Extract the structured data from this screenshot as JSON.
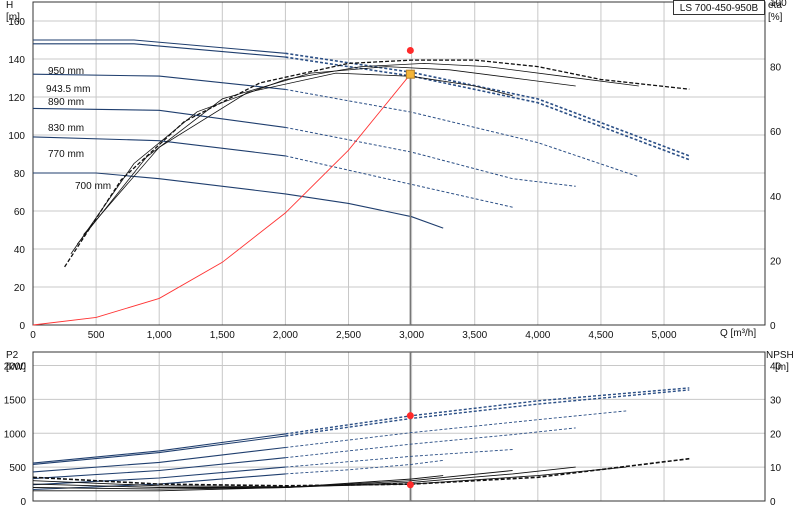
{
  "chart_data": [
    {
      "type": "line",
      "product": "LS 700-450-950B",
      "left_axis": {
        "title": "H",
        "unit": "[m]",
        "ylim": [
          0,
          170
        ],
        "ticks": [
          0,
          20,
          40,
          60,
          80,
          100,
          120,
          140,
          160
        ]
      },
      "right_axis": {
        "title": "eta",
        "unit": "[%]",
        "ylim": [
          0,
          100
        ],
        "ticks": [
          0,
          20,
          40,
          60,
          80,
          100
        ]
      },
      "x_axis": {
        "title": "Q [m³/h]",
        "xlim": [
          0,
          5800
        ],
        "ticks": [
          0,
          500,
          1000,
          1500,
          2000,
          2500,
          3000,
          3500,
          4000,
          4500,
          5000
        ],
        "tick_labels": [
          "0",
          "500",
          "1,000",
          "1,500",
          "2,000",
          "2,500",
          "3,000",
          "3,500",
          "4,000",
          "4,500",
          "5,000"
        ]
      },
      "grid": true,
      "head_curves": [
        {
          "name": "950 mm",
          "points": [
            [
              0,
              150
            ],
            [
              800,
              150
            ],
            [
              2000,
              143
            ],
            [
              3000,
              133
            ],
            [
              4000,
              119
            ],
            [
              5200,
              89
            ]
          ]
        },
        {
          "name": "943.5 mm",
          "points": [
            [
              0,
              148
            ],
            [
              800,
              148
            ],
            [
              2000,
              141
            ],
            [
              3000,
              131
            ],
            [
              4000,
              117
            ],
            [
              5200,
              87
            ]
          ]
        },
        {
          "name": "890 mm",
          "points": [
            [
              0,
              132
            ],
            [
              1000,
              131
            ],
            [
              2000,
              124
            ],
            [
              3000,
              112
            ],
            [
              4000,
              96
            ],
            [
              4800,
              78
            ]
          ]
        },
        {
          "name": "830 mm",
          "points": [
            [
              0,
              114
            ],
            [
              1000,
              113
            ],
            [
              2000,
              104
            ],
            [
              3000,
              91
            ],
            [
              3800,
              77
            ],
            [
              4300,
              73
            ]
          ]
        },
        {
          "name": "770 mm",
          "points": [
            [
              0,
              99
            ],
            [
              1000,
              97
            ],
            [
              2000,
              89
            ],
            [
              3000,
              74
            ],
            [
              3800,
              62
            ]
          ]
        },
        {
          "name": "700 mm",
          "points": [
            [
              0,
              80
            ],
            [
              500,
              80
            ],
            [
              1000,
              77
            ],
            [
              2000,
              69
            ],
            [
              2500,
              64
            ],
            [
              3000,
              57
            ],
            [
              3250,
              51
            ]
          ]
        }
      ],
      "efficiency_curves": [
        {
          "points": [
            [
              250,
              18
            ],
            [
              700,
              45
            ],
            [
              1200,
              63
            ],
            [
              1800,
              75
            ],
            [
              2500,
              81
            ],
            [
              3000,
              82
            ],
            [
              3500,
              82
            ],
            [
              4000,
              80
            ],
            [
              4500,
              76
            ],
            [
              5200,
              73
            ]
          ]
        },
        {
          "points": [
            [
              300,
              22
            ],
            [
              800,
              50
            ],
            [
              1300,
              66
            ],
            [
              2000,
              76
            ],
            [
              2600,
              80
            ],
            [
              3100,
              81
            ],
            [
              3600,
              80
            ],
            [
              4200,
              77
            ],
            [
              4800,
              74
            ]
          ]
        },
        {
          "points": [
            [
              350,
              25
            ],
            [
              900,
              52
            ],
            [
              1500,
              70
            ],
            [
              2200,
              78
            ],
            [
              2800,
              80
            ],
            [
              3300,
              79
            ],
            [
              3900,
              76
            ],
            [
              4300,
              74
            ]
          ]
        },
        {
          "points": [
            [
              400,
              28
            ],
            [
              1000,
              55
            ],
            [
              1700,
              72
            ],
            [
              2400,
              78
            ],
            [
              3000,
              77
            ],
            [
              3500,
              74
            ],
            [
              3800,
              71
            ]
          ]
        }
      ],
      "system_curve": {
        "points": [
          [
            0,
            0
          ],
          [
            500,
            4
          ],
          [
            1000,
            14
          ],
          [
            1500,
            33
          ],
          [
            2000,
            59
          ],
          [
            2500,
            92
          ],
          [
            2990,
            132
          ]
        ]
      },
      "duty_point": {
        "q": 2990,
        "h": 132
      },
      "duty_eff": {
        "q": 2990,
        "eta": 85
      },
      "duty_line": {
        "q": 2990
      }
    },
    {
      "type": "line",
      "left_axis": {
        "title": "P2",
        "unit": "[kW]",
        "ylim": [
          0,
          2200
        ],
        "ticks": [
          0,
          500,
          1000,
          1500,
          2000
        ]
      },
      "right_axis": {
        "title": "NPSH",
        "unit": "[m]",
        "ylim": [
          0,
          44
        ],
        "ticks": [
          0,
          10,
          20,
          30,
          40
        ]
      },
      "x_axis": {
        "xlim": [
          0,
          5800
        ],
        "ticks": [
          0,
          500,
          1000,
          1500,
          2000,
          2500,
          3000,
          3500,
          4000,
          4500,
          5000
        ]
      },
      "grid": true,
      "power_curves": [
        {
          "points": [
            [
              0,
              560
            ],
            [
              1000,
              740
            ],
            [
              2000,
              990
            ],
            [
              3000,
              1260
            ],
            [
              4000,
              1480
            ],
            [
              5200,
              1670
            ]
          ]
        },
        {
          "points": [
            [
              0,
              540
            ],
            [
              1000,
              715
            ],
            [
              2000,
              960
            ],
            [
              3000,
              1220
            ],
            [
              4000,
              1430
            ],
            [
              5200,
              1640
            ]
          ]
        },
        {
          "points": [
            [
              0,
              430
            ],
            [
              1000,
              570
            ],
            [
              2000,
              790
            ],
            [
              3000,
              1010
            ],
            [
              4000,
              1200
            ],
            [
              4700,
              1330
            ]
          ]
        },
        {
          "points": [
            [
              0,
              330
            ],
            [
              1000,
              450
            ],
            [
              2000,
              640
            ],
            [
              3000,
              840
            ],
            [
              3800,
              980
            ],
            [
              4300,
              1080
            ]
          ]
        },
        {
          "points": [
            [
              0,
              240
            ],
            [
              1000,
              340
            ],
            [
              2000,
              500
            ],
            [
              3000,
              660
            ],
            [
              3800,
              760
            ]
          ]
        },
        {
          "points": [
            [
              0,
              170
            ],
            [
              1000,
              250
            ],
            [
              2000,
              400
            ],
            [
              2500,
              460
            ],
            [
              3000,
              540
            ],
            [
              3250,
              600
            ]
          ]
        }
      ],
      "npsh_curves": [
        {
          "points": [
            [
              0,
              7
            ],
            [
              1000,
              5
            ],
            [
              2000,
              4.5
            ],
            [
              3000,
              5
            ],
            [
              4000,
              7
            ],
            [
              5200,
              12.5
            ]
          ]
        },
        {
          "points": [
            [
              0,
              6
            ],
            [
              1000,
              4.5
            ],
            [
              2000,
              4.2
            ],
            [
              3000,
              5
            ],
            [
              4000,
              7.5
            ],
            [
              4700,
              10
            ]
          ]
        },
        {
          "points": [
            [
              0,
              5
            ],
            [
              1000,
              4
            ],
            [
              2000,
              4
            ],
            [
              3000,
              5.5
            ],
            [
              3800,
              8
            ],
            [
              4300,
              10
            ]
          ]
        },
        {
          "points": [
            [
              0,
              4
            ],
            [
              1000,
              3.5
            ],
            [
              2000,
              4
            ],
            [
              3000,
              6
            ],
            [
              3800,
              9
            ]
          ]
        },
        {
          "points": [
            [
              0,
              3
            ],
            [
              1000,
              3
            ],
            [
              2000,
              4
            ],
            [
              3000,
              6.5
            ],
            [
              3250,
              7.5
            ]
          ]
        }
      ],
      "duty_power": {
        "q": 2990,
        "p2": 1260
      },
      "duty_npsh": {
        "q": 2990,
        "npsh": 4.8
      }
    }
  ],
  "legend": {
    "product": "LS 700-450-950B"
  },
  "labels": {
    "d950": "950 mm",
    "d943": "943.5 mm",
    "d890": "890 mm",
    "d830": "830 mm",
    "d770": "770 mm",
    "d700": "700 mm"
  },
  "colors": {
    "head": "#1f3e6e",
    "head_dash": "#2b4f86",
    "eff": "#111111",
    "system": "#ff3333",
    "duty": "#ff2a2a",
    "duty_marker": "#f3b53a",
    "grid": "#c8c8c8",
    "duty_line": "#777777"
  }
}
